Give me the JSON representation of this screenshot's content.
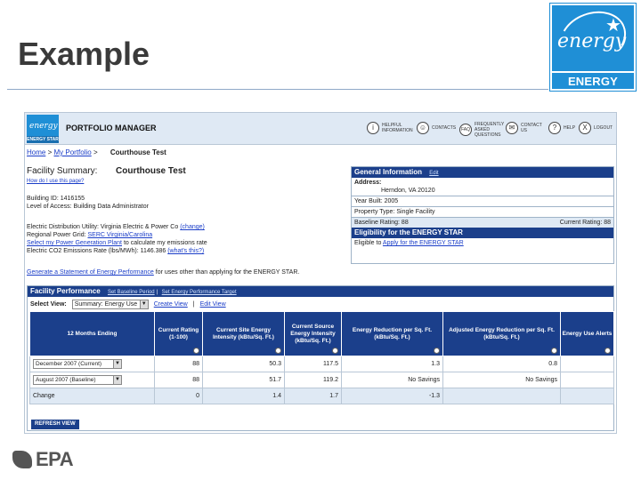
{
  "slide": {
    "title": "Example"
  },
  "logo": {
    "script": "energy",
    "label": "ENERGY STAR",
    "brand_color": "#1f8fd6"
  },
  "pm": {
    "title": "PORTFOLIO MANAGER",
    "logo_caption": "ENERGY STAR",
    "nav": [
      {
        "icon": "info-icon",
        "glyph": "i",
        "label": "Helpful Information"
      },
      {
        "icon": "contacts-icon",
        "glyph": "☺",
        "label": "Contacts"
      },
      {
        "icon": "faq-icon",
        "glyph": "FAQ",
        "label": "Frequently Asked Questions"
      },
      {
        "icon": "contact-us-icon",
        "glyph": "✉",
        "label": "Contact Us"
      },
      {
        "icon": "help-icon",
        "glyph": "?",
        "label": "Help"
      },
      {
        "icon": "logout-icon",
        "glyph": "X",
        "label": "Logout"
      }
    ],
    "breadcrumb": {
      "home": "Home",
      "sep": ">",
      "portfolio": "My Portfolio",
      "current": "Courthouse Test"
    },
    "facility_summary_label": "Facility Summary:",
    "facility_name": "Courthouse Test",
    "how_to": "How do I use this page?",
    "building_id": "Building ID: 1416155",
    "access_level": "Level of Access: Building Data Administrator",
    "utility_line1": "Electric Distribution Utility: Virginia Electric & Power Co",
    "utility_change": "(change)",
    "power_grid_label": "Regional Power Grid:",
    "power_grid_value": "SERC Virginia/Carolina",
    "select_power_plant": "Select my Power Generation Plant",
    "select_power_plant_rest": " to calculate my emissions rate",
    "co2_line": "Electric CO2 Emissions Rate (lbs/MWh): 1146.386",
    "co2_link": "(what's this?)",
    "generate_stmt_link": "Generate a Statement of Energy Performance",
    "generate_stmt_rest": " for uses other than applying for the ENERGY STAR."
  },
  "general_info": {
    "heading": "General Information",
    "edit": "Edit",
    "address_label": "Address:",
    "address_value": "Herndon, VA 20120",
    "year_built": "Year Built: 2005",
    "property_type": "Property Type: Single Facility",
    "baseline_rating": "Baseline Rating: 88",
    "current_rating": "Current Rating: 88",
    "eligibility_heading": "Eligibility for the ENERGY STAR",
    "eligible_text": "Eligible to ",
    "eligible_link": "Apply for the ENERGY STAR"
  },
  "performance": {
    "heading": "Facility Performance",
    "link_baseline": "Set Baseline Period",
    "link_target": "Set Energy Performance Target",
    "divider": "|",
    "select_view_label": "Select View:",
    "select_view_value": "Summary: Energy Use",
    "create_view": "Create View",
    "edit_view": "Edit View",
    "columns": [
      "12 Months Ending",
      "Current Rating (1-100)",
      "Current Site Energy Intensity (kBtu/Sq. Ft.)",
      "Current Source Energy Intensity (kBtu/Sq. Ft.)",
      "Energy Reduction per Sq. Ft. (kBtu/Sq. Ft.)",
      "Adjusted Energy Reduction per Sq. Ft. (kBtu/Sq. Ft.)",
      "Energy Use Alerts"
    ],
    "rows": [
      {
        "period": "December 2007 (Current)",
        "rating": "88",
        "site": "50.3",
        "source": "117.5",
        "reduction": "1.3",
        "adjusted": "0.8",
        "alerts": ""
      },
      {
        "period": "August 2007 (Baseline)",
        "rating": "88",
        "site": "51.7",
        "source": "119.2",
        "reduction": "No Savings",
        "adjusted": "No Savings",
        "alerts": ""
      }
    ],
    "change": {
      "label": "Change",
      "rating": "0",
      "site": "1.4",
      "source": "1.7",
      "reduction": "-1.3",
      "adjusted": "",
      "alerts": ""
    },
    "refresh_label": "REFRESH VIEW"
  },
  "footer": {
    "epa": "EPA"
  }
}
